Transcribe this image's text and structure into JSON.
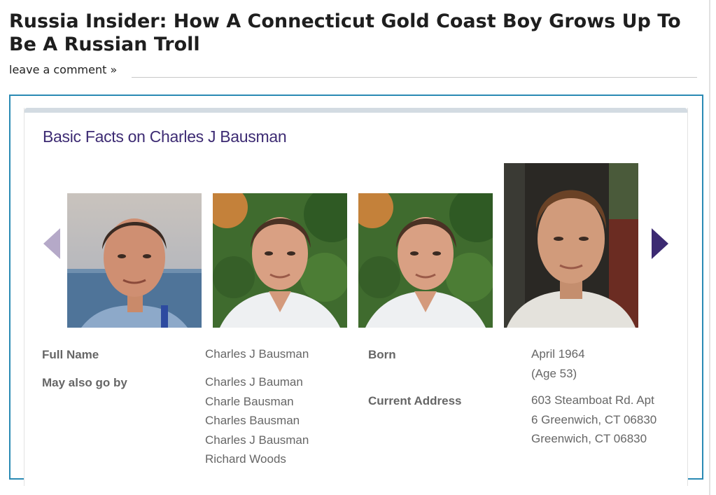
{
  "post": {
    "title": "Russia Insider: How A Connecticut Gold Coast Boy Grows Up To Be A Russian Troll",
    "comment_link": "leave a comment »"
  },
  "card": {
    "title": "Basic Facts on Charles J Bausman",
    "prev_icon": "triangle-left",
    "next_icon": "triangle-right"
  },
  "facts": {
    "full_name_label": "Full Name",
    "full_name": "Charles J Bausman",
    "aka_label": "May also go by",
    "aliases": [
      "Charles J Bauman",
      "Charle Bausman",
      "Charles Bausman",
      "Charles J Bausman",
      "Richard Woods"
    ],
    "born_label": "Born",
    "born_date": "April 1964",
    "born_age": "(Age 53)",
    "address_label": "Current Address",
    "address_lines": [
      "603 Steamboat Rd. Apt",
      "6 Greenwich, CT 06830",
      "Greenwich, CT 06830"
    ]
  },
  "colors": {
    "frame": "#2a8ab4",
    "card_title": "#3d2b73",
    "arrow_next": "#3c2a72",
    "arrow_prev": "#b5a9c8"
  }
}
